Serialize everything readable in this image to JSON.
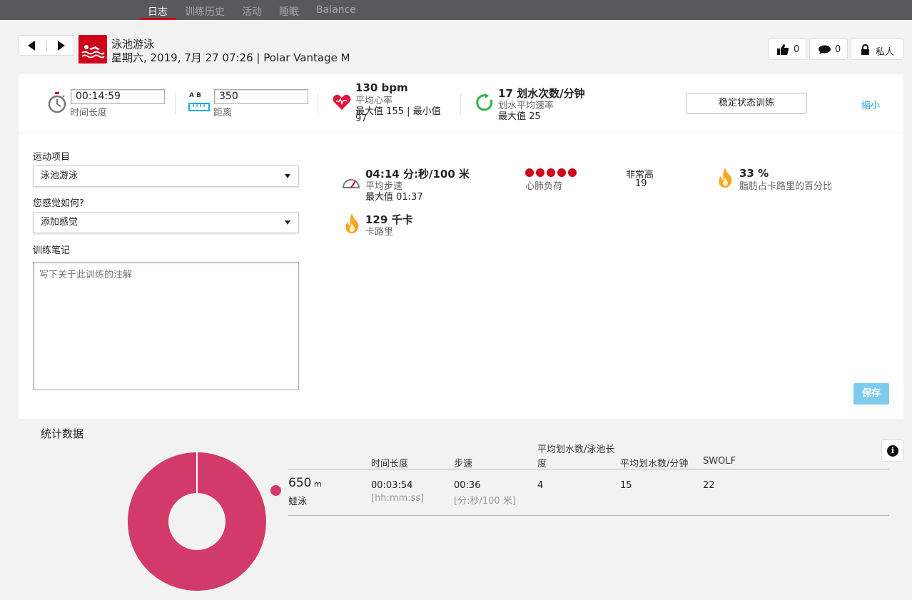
{
  "nav": {
    "items": [
      "日志",
      "训练历史",
      "活动",
      "睡眠",
      "Balance"
    ],
    "active_index": 0
  },
  "header": {
    "sport_name": "泳池游泳",
    "date_device": "星期六, 2019, 7月 27 07:26 | Polar Vantage M",
    "likes": "0",
    "comments": "0",
    "privacy": "私人"
  },
  "summary": {
    "duration_value": "00:14:59",
    "duration_label": "时间长度",
    "distance_ab": "A B",
    "distance_value": "350",
    "distance_label": "距离",
    "hr_value": "130 bpm",
    "hr_label": "平均心率",
    "hr_minmax_line1": "最大值 155  |  最小值",
    "hr_min": "97",
    "stroke_value": "17 划水次数/分钟",
    "stroke_label": "划水平均速率",
    "stroke_max": "最大值 25",
    "steady_button": "稳定状态训练",
    "shrink_link": "缩小"
  },
  "form": {
    "sport_label": "运动项目",
    "sport_value": "泳池游泳",
    "feeling_label": "您感觉如何?",
    "feeling_value": "添加感觉",
    "notes_label": "训练笔记",
    "notes_placeholder": "写下关于此训练的注解",
    "save_button": "保存"
  },
  "metrics": {
    "pace_value": "04:14 分:秒/100 米",
    "pace_label": "平均步速",
    "pace_max": "最大值 01:37",
    "cardio_label": "心肺负荷",
    "cardio_dots": 5,
    "cardio_level": "非常高",
    "cardio_value": "19",
    "fat_value": "33 %",
    "fat_label": "脂肪占卡路里的百分比",
    "calories_value": "129 千卡",
    "calories_label": "卡路里"
  },
  "stats": {
    "title": "统计数据",
    "columns": {
      "duration": "时间长度",
      "pace": "步速",
      "strokes_per_length_line1": "平均划水数/泳池长",
      "strokes_per_length_line2": "度",
      "strokes_per_min": "平均划水数/分钟",
      "swolf": "SWOLF"
    },
    "row": {
      "distance": "650",
      "distance_unit": "m",
      "style": "蛙泳",
      "duration": "00:03:54",
      "duration_unit": "[hh:mm:ss]",
      "pace": "00:36",
      "pace_unit": "[分:秒/100 米]",
      "strokes_per_length": "4",
      "strokes_per_min": "15",
      "swolf": "22"
    },
    "donut_color": "#d23a69",
    "donut_share": 1.0
  },
  "colors": {
    "brand_red": "#d0021b",
    "link_blue": "#1ea7e1",
    "save_blue": "#7fcbee"
  }
}
